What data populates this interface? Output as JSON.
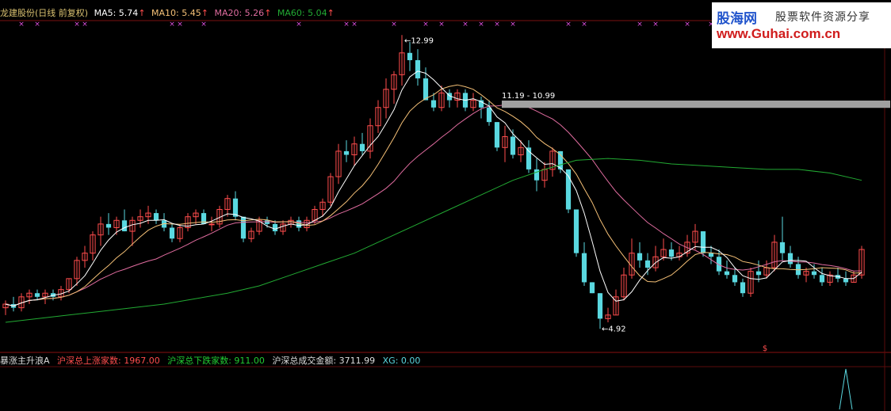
{
  "header": {
    "stock_title": "龙建股份(日线 前复权)",
    "ma5_label": "MA5: 5.74",
    "ma10_label": "MA10: 5.45",
    "ma20_label": "MA20: 5.26",
    "ma60_label": "MA60: 5.04",
    "arrow": "↑"
  },
  "indicator": {
    "title": "暴涨主升浪A",
    "up_label": "沪深总上涨家数: 1967.00",
    "down_label": "沪深总下跌家数: 911.00",
    "turnover_label": "沪深总成交金额: 3711.99",
    "xg_label": "XG: 0.00"
  },
  "watermark": {
    "brand": "股海网",
    "slogan": "股票软件资源分享",
    "url": "www.Guhai.com.cn"
  },
  "annotations": {
    "high": "12.99",
    "low": "4.92",
    "gap": "11.19 - 10.99"
  },
  "colors": {
    "up": "#ff4d4d",
    "down": "#5ad8e0",
    "ma5": "#ffffff",
    "ma10": "#f6c177",
    "ma20": "#e06c9f",
    "ma60": "#22aa33",
    "gap_bar": "#a0a0a0",
    "marker": "#e050e0"
  },
  "chart_data": {
    "type": "candlestick",
    "price_range": [
      4.6,
      13.3
    ],
    "candles": [
      [
        5.5,
        5.7,
        5.3,
        5.6
      ],
      [
        5.6,
        5.8,
        5.4,
        5.5
      ],
      [
        5.5,
        5.9,
        5.4,
        5.8
      ],
      [
        5.8,
        6.0,
        5.6,
        5.9
      ],
      [
        5.9,
        6.0,
        5.7,
        5.8
      ],
      [
        5.8,
        6.0,
        5.6,
        5.9
      ],
      [
        5.9,
        6.0,
        5.7,
        5.8
      ],
      [
        5.8,
        6.1,
        5.7,
        6.0
      ],
      [
        6.0,
        6.3,
        5.9,
        6.3
      ],
      [
        6.3,
        6.9,
        6.1,
        6.8
      ],
      [
        6.8,
        7.2,
        6.6,
        7.0
      ],
      [
        7.0,
        7.6,
        6.8,
        7.5
      ],
      [
        7.5,
        8.0,
        7.2,
        7.8
      ],
      [
        7.8,
        8.1,
        7.5,
        7.7
      ],
      [
        7.7,
        8.0,
        7.5,
        7.9
      ],
      [
        7.9,
        8.2,
        7.6,
        7.6
      ],
      [
        7.6,
        8.0,
        7.2,
        7.9
      ],
      [
        7.9,
        8.2,
        7.7,
        8.0
      ],
      [
        8.0,
        8.3,
        7.8,
        8.1
      ],
      [
        8.1,
        8.2,
        7.8,
        7.9
      ],
      [
        7.9,
        8.1,
        7.6,
        7.7
      ],
      [
        7.7,
        7.8,
        7.3,
        7.4
      ],
      [
        7.4,
        7.8,
        7.3,
        7.7
      ],
      [
        7.7,
        8.1,
        7.6,
        8.0
      ],
      [
        8.0,
        8.2,
        7.8,
        8.1
      ],
      [
        8.1,
        8.2,
        7.8,
        7.8
      ],
      [
        7.8,
        8.0,
        7.6,
        7.8
      ],
      [
        7.8,
        8.3,
        7.7,
        8.2
      ],
      [
        8.2,
        8.6,
        8.0,
        8.5
      ],
      [
        8.5,
        8.7,
        7.9,
        8.0
      ],
      [
        8.0,
        8.0,
        7.3,
        7.4
      ],
      [
        7.4,
        7.7,
        7.3,
        7.6
      ],
      [
        7.6,
        8.0,
        7.5,
        7.9
      ],
      [
        7.9,
        8.0,
        7.7,
        7.8
      ],
      [
        7.8,
        7.9,
        7.5,
        7.6
      ],
      [
        7.6,
        7.9,
        7.5,
        7.8
      ],
      [
        7.8,
        8.0,
        7.7,
        7.9
      ],
      [
        7.9,
        8.0,
        7.6,
        7.7
      ],
      [
        7.7,
        8.0,
        7.6,
        7.9
      ],
      [
        7.9,
        8.3,
        7.8,
        8.2
      ],
      [
        8.2,
        8.5,
        8.0,
        8.4
      ],
      [
        8.4,
        9.2,
        8.3,
        9.1
      ],
      [
        9.1,
        10.0,
        8.9,
        9.8
      ],
      [
        9.8,
        10.1,
        9.5,
        9.7
      ],
      [
        9.7,
        10.2,
        9.4,
        10.0
      ],
      [
        10.0,
        10.3,
        9.7,
        9.8
      ],
      [
        9.8,
        10.7,
        9.6,
        10.5
      ],
      [
        10.5,
        11.2,
        10.3,
        11.0
      ],
      [
        11.0,
        11.8,
        10.7,
        11.5
      ],
      [
        11.5,
        12.0,
        11.1,
        11.9
      ],
      [
        11.9,
        12.99,
        11.6,
        12.5
      ],
      [
        12.5,
        12.8,
        12.0,
        12.3
      ],
      [
        12.3,
        12.6,
        11.6,
        11.8
      ],
      [
        11.8,
        12.1,
        11.2,
        11.2
      ],
      [
        11.2,
        11.4,
        10.9,
        11.0
      ],
      [
        11.0,
        11.6,
        10.9,
        11.4
      ],
      [
        11.4,
        11.5,
        11.0,
        11.2
      ],
      [
        11.2,
        11.5,
        11.0,
        11.4
      ],
      [
        11.4,
        11.5,
        10.9,
        11.0
      ],
      [
        11.0,
        11.4,
        10.9,
        11.2
      ],
      [
        11.2,
        11.3,
        10.7,
        11.0
      ],
      [
        11.0,
        11.2,
        10.5,
        10.6
      ],
      [
        10.6,
        10.6,
        9.8,
        9.9
      ],
      [
        9.9,
        10.5,
        9.5,
        10.2
      ],
      [
        10.2,
        10.4,
        9.6,
        9.7
      ],
      [
        9.7,
        10.1,
        9.5,
        9.9
      ],
      [
        9.9,
        10.1,
        9.2,
        9.3
      ],
      [
        9.3,
        9.6,
        8.7,
        9.0
      ],
      [
        9.0,
        9.5,
        8.8,
        9.3
      ],
      [
        9.3,
        9.9,
        9.1,
        9.8
      ],
      [
        9.8,
        9.8,
        9.2,
        9.3
      ],
      [
        9.3,
        9.3,
        8.1,
        8.2
      ],
      [
        8.2,
        8.2,
        6.9,
        7.0
      ],
      [
        7.0,
        7.3,
        6.1,
        6.2
      ],
      [
        6.2,
        6.2,
        5.9,
        5.9
      ],
      [
        5.9,
        5.9,
        4.92,
        5.2
      ],
      [
        5.2,
        5.5,
        5.1,
        5.3
      ],
      [
        5.3,
        6.0,
        5.3,
        5.8
      ],
      [
        5.8,
        6.6,
        5.7,
        6.4
      ],
      [
        6.4,
        7.4,
        6.3,
        7.0
      ],
      [
        7.0,
        7.3,
        6.6,
        6.8
      ],
      [
        6.8,
        7.0,
        6.4,
        6.6
      ],
      [
        6.6,
        7.2,
        6.5,
        6.9
      ],
      [
        6.9,
        7.4,
        6.8,
        7.1
      ],
      [
        7.1,
        7.3,
        6.8,
        6.9
      ],
      [
        6.9,
        7.2,
        6.8,
        7.0
      ],
      [
        7.0,
        7.5,
        6.9,
        7.3
      ],
      [
        7.3,
        7.8,
        7.1,
        7.6
      ],
      [
        7.6,
        7.6,
        6.9,
        7.0
      ],
      [
        7.0,
        7.2,
        6.7,
        6.9
      ],
      [
        6.9,
        7.1,
        6.4,
        6.5
      ],
      [
        6.5,
        6.8,
        6.3,
        6.4
      ],
      [
        6.4,
        6.6,
        6.1,
        6.2
      ],
      [
        6.2,
        6.3,
        5.8,
        5.9
      ],
      [
        5.9,
        6.6,
        5.8,
        6.5
      ],
      [
        6.5,
        6.8,
        6.2,
        6.4
      ],
      [
        6.4,
        6.8,
        6.3,
        6.6
      ],
      [
        6.6,
        7.5,
        6.5,
        7.3
      ],
      [
        7.3,
        8.0,
        6.8,
        7.0
      ],
      [
        7.0,
        7.2,
        6.6,
        6.7
      ],
      [
        6.7,
        6.9,
        6.3,
        6.4
      ],
      [
        6.4,
        6.6,
        6.2,
        6.5
      ],
      [
        6.5,
        6.7,
        6.3,
        6.4
      ],
      [
        6.4,
        6.6,
        6.1,
        6.2
      ],
      [
        6.2,
        6.5,
        6.1,
        6.4
      ],
      [
        6.4,
        6.6,
        6.2,
        6.3
      ],
      [
        6.3,
        6.5,
        6.1,
        6.2
      ],
      [
        6.2,
        6.5,
        6.2,
        6.4
      ],
      [
        6.4,
        7.2,
        6.3,
        7.1
      ]
    ],
    "ma60_series": [
      5.1,
      5.2,
      5.3,
      5.4,
      5.5,
      5.6,
      5.75,
      5.9,
      6.1,
      6.4,
      6.7,
      7.0,
      7.4,
      7.8,
      8.2,
      8.6,
      9.0,
      9.3,
      9.55,
      9.6,
      9.55,
      9.45,
      9.4,
      9.35,
      9.3,
      9.3,
      9.2,
      9.0
    ],
    "indicator_range": [
      0,
      1
    ],
    "indicator_spike": {
      "index": 108,
      "value": 1
    }
  }
}
